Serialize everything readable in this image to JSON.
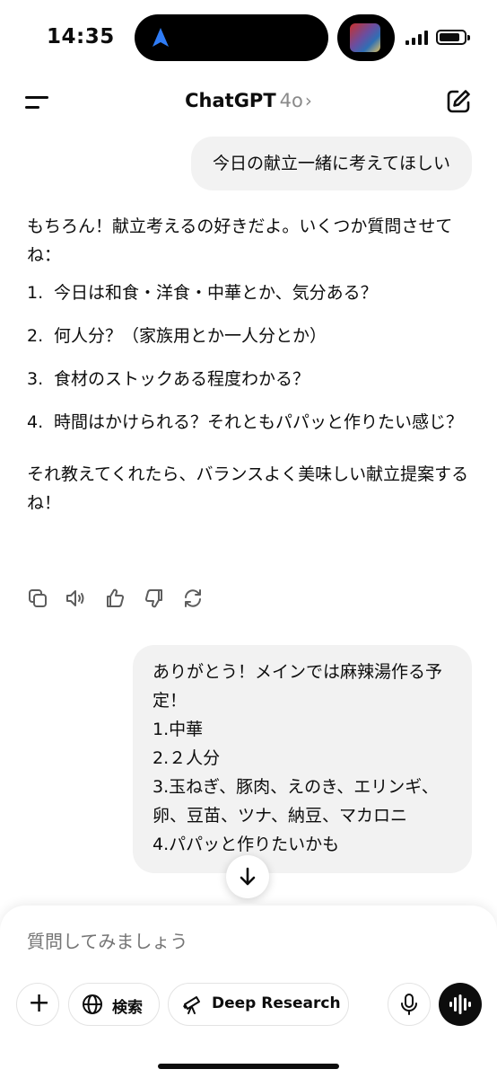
{
  "status_bar": {
    "time": "14:35",
    "battery_level": 0.85
  },
  "header": {
    "app_name": "ChatGPT",
    "model": "4o",
    "chevron": "›"
  },
  "messages": {
    "user_1": "今日の献立一緒に考えてほしい",
    "assistant_1": {
      "intro": "もちろん！献立考えるの好きだよ。いくつか質問させてね：",
      "items": [
        {
          "num": "1.",
          "text": "今日は和食・洋食・中華とか、気分ある？"
        },
        {
          "num": "2.",
          "text": "何人分？（家族用とか一人分とか）"
        },
        {
          "num": "3.",
          "text": "食材のストックある程度わかる？"
        },
        {
          "num": "4.",
          "text": "時間はかけられる？それともパパッと作りたい感じ？"
        }
      ],
      "outro": "それ教えてくれたら、バランスよく美味しい献立提案するね！"
    },
    "user_2": {
      "lines": [
        "ありがとう！メインでは麻辣湯作る予定！",
        "1.中華",
        "2.２人分",
        "3.玉ねぎ、豚肉、えのき、エリンギ、卵、豆苗、ツナ、納豆、マカロニ",
        "4.パパッと作りたいかも"
      ]
    }
  },
  "message_actions": [
    "copy-icon",
    "speaker-icon",
    "thumbs-up-icon",
    "thumbs-down-icon",
    "regenerate-icon"
  ],
  "composer": {
    "placeholder": "質問してみましょう",
    "search_label": "検索",
    "research_label": "Deep Research"
  },
  "colors": {
    "bubble": "#f2f2f2",
    "text": "#0d0d0d",
    "muted": "#8e8e8e",
    "nav_arrow": "#2f7cf6"
  }
}
